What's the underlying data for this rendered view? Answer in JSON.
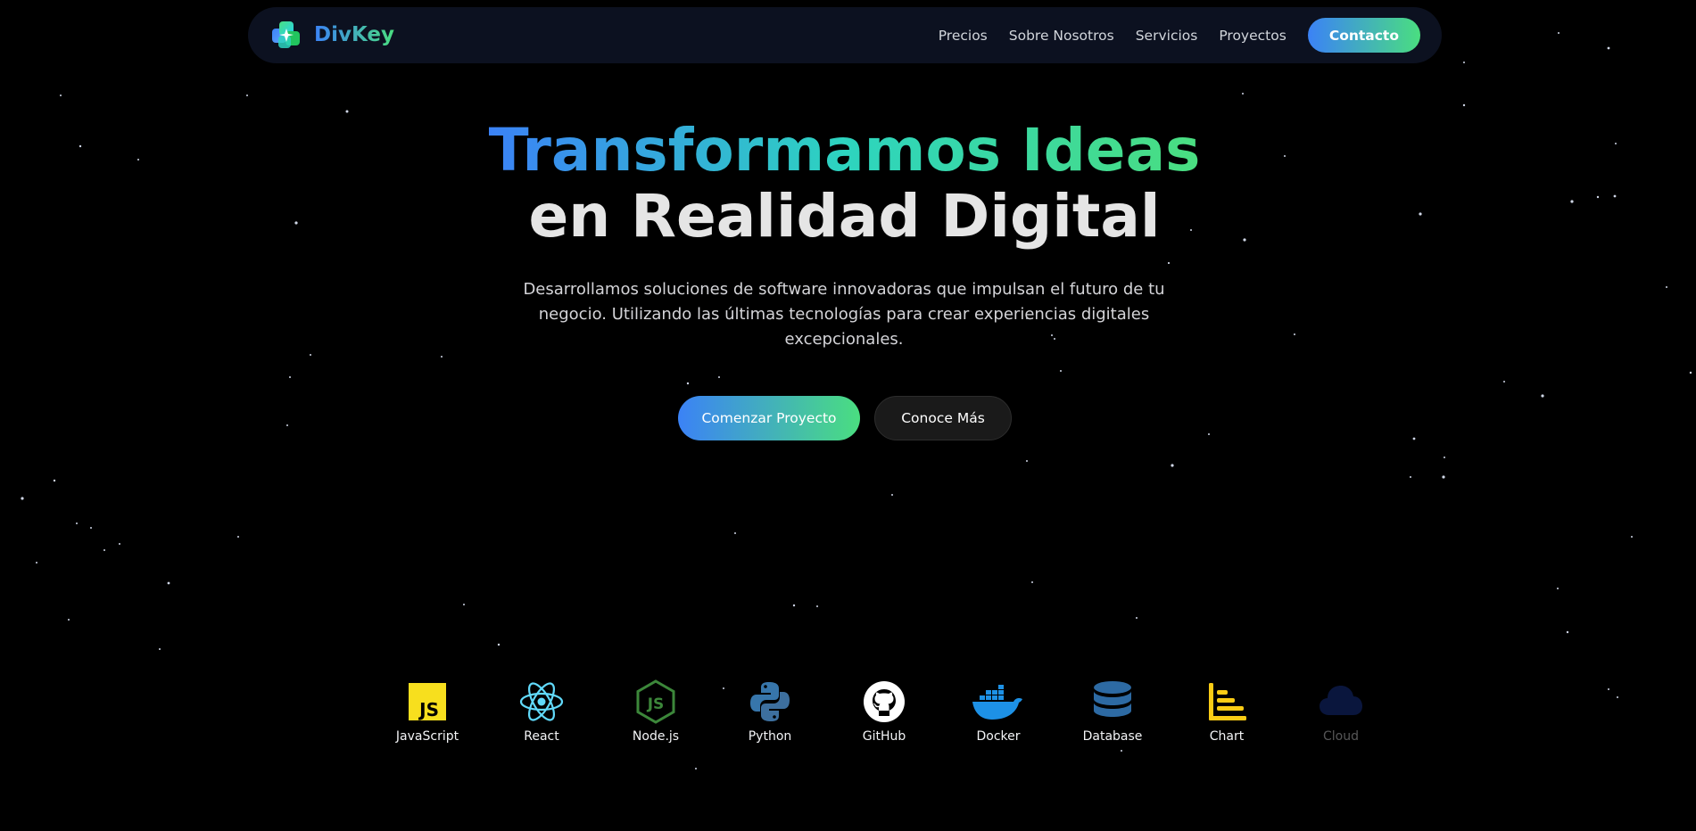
{
  "nav": {
    "brand": "DivKey",
    "links": [
      "Precios",
      "Sobre Nosotros",
      "Servicios",
      "Proyectos"
    ],
    "cta": "Contacto"
  },
  "hero": {
    "title_line1": "Transformamos Ideas",
    "title_line2": "en Realidad Digital",
    "subtitle": "Desarrollamos soluciones de software innovadoras que impulsan el futuro de tu negocio. Utilizando las últimas tecnologías para crear experiencias digitales excepcionales.",
    "primary_button": "Comenzar Proyecto",
    "secondary_button": "Conoce Más"
  },
  "tech": {
    "items": [
      {
        "label": "JavaScript",
        "icon": "javascript-icon",
        "color": "#f7df1e"
      },
      {
        "label": "React",
        "icon": "react-icon",
        "color": "#61dafb"
      },
      {
        "label": "Node.js",
        "icon": "nodejs-icon",
        "color": "#3c873a"
      },
      {
        "label": "Python",
        "icon": "python-icon",
        "color": "#3776ab"
      },
      {
        "label": "GitHub",
        "icon": "github-icon",
        "color": "#ffffff"
      },
      {
        "label": "Docker",
        "icon": "docker-icon",
        "color": "#1d91e6"
      },
      {
        "label": "Database",
        "icon": "database-icon",
        "color": "#2d6aa3"
      },
      {
        "label": "Chart",
        "icon": "chart-icon",
        "color": "#facc15"
      },
      {
        "label": "Cloud",
        "icon": "cloud-icon",
        "color": "#1e3a8a"
      }
    ]
  },
  "colors": {
    "background": "#000000",
    "nav_bg": "#0c1120",
    "gradient_start": "#3b82f6",
    "gradient_end": "#4ade80"
  }
}
